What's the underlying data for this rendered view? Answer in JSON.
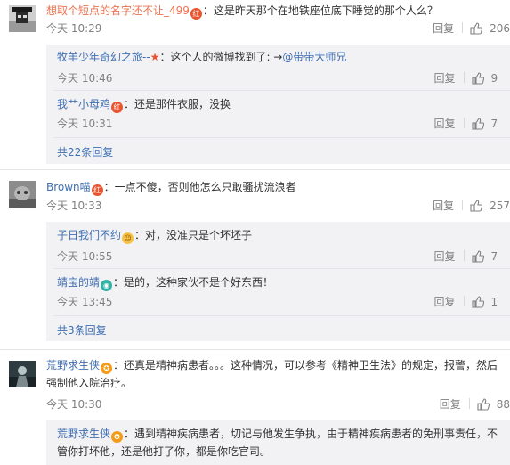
{
  "ui": {
    "reply_label": "回复",
    "thumb_icon": "thumb-up-icon"
  },
  "comments": [
    {
      "user": "想取个短点的名字还不让_499",
      "badge": "红",
      "text": "：这是昨天那个在地铁座位底下睡觉的那个人么？",
      "time": "今天 10:29",
      "likes": "206",
      "replies": [
        {
          "user": "牧羊少年奇幻之旅--",
          "badge": "★",
          "text": "：这个人的微博找到了: →",
          "mention": "@带带大师兄",
          "time": "今天 10:46",
          "likes": "9"
        },
        {
          "user": "我艹小母鸡",
          "badge": "红",
          "text": "：还是那件衣服，没换",
          "mention": "",
          "time": "今天 10:31",
          "likes": "7"
        }
      ],
      "more": "共22条回复"
    },
    {
      "user": "Brown喵",
      "badge": "红",
      "text": "：一点不傻，否则他怎么只敢骚扰流浪者",
      "time": "今天 10:33",
      "likes": "257",
      "replies": [
        {
          "user": "子日我们不约",
          "badge": "☺",
          "text": "：对，没准只是个坏坯子",
          "mention": "",
          "time": "今天 10:55",
          "likes": "7"
        },
        {
          "user": "靖宝的靖",
          "badge": "◉",
          "text": "：是的，这种家伙不是个好东西！",
          "mention": "",
          "time": "今天 13:45",
          "likes": "1"
        }
      ],
      "more": "共3条回复"
    },
    {
      "user": "荒野求生侠",
      "badge": "✪",
      "text": "：还真是精神病患者。。。这种情况，可以参考《精神卫生法》的规定，报警，然后强制他入院治疗。",
      "time": "今天 10:30",
      "likes": "88",
      "replies": [
        {
          "user": "荒野求生侠",
          "badge": "✪",
          "text": "：遇到精神疾病患者，切记与他发生争执，由于精神疾病患者的免刑事责任，不管你打坏他，还是他打了你，都是你吃官司。",
          "mention": "",
          "time": "",
          "likes": ""
        }
      ],
      "more": ""
    }
  ]
}
